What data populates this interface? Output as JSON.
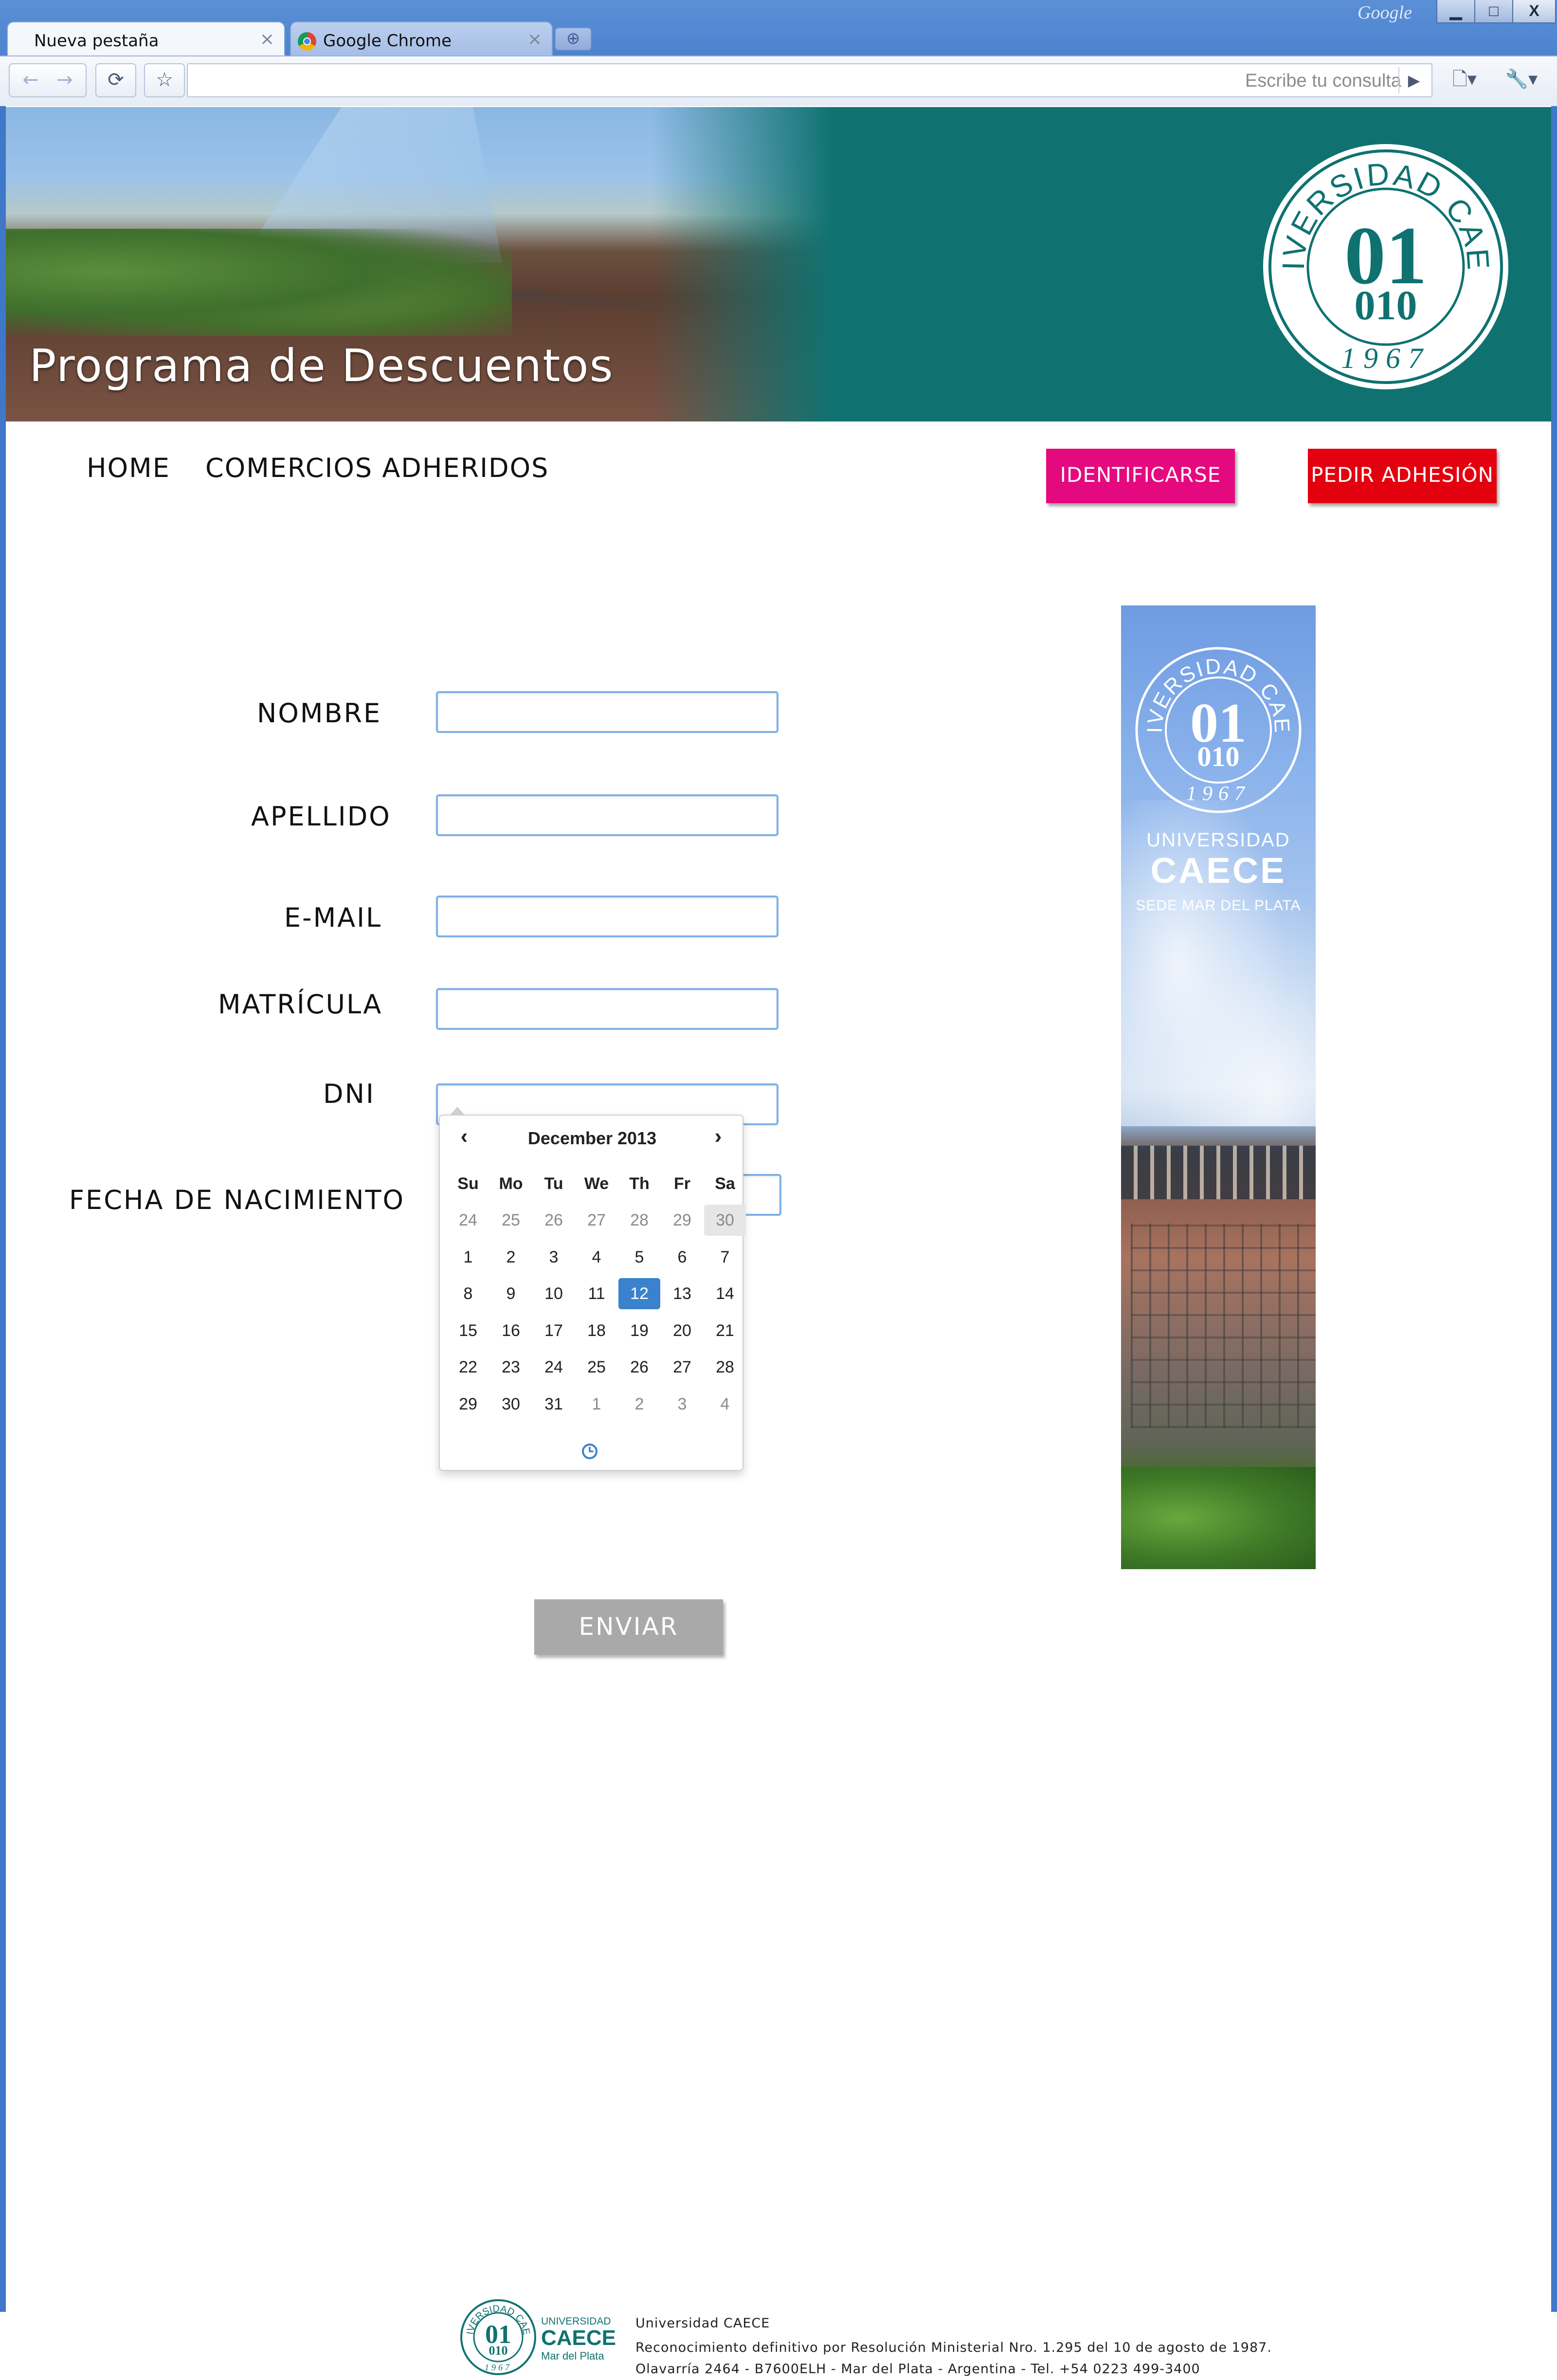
{
  "browser": {
    "tabs": [
      {
        "label": "Nueva pestaña",
        "active": true
      },
      {
        "label": "Google Chrome",
        "active": false
      }
    ],
    "window_brand": "Google",
    "omnibox": {
      "value": "",
      "placeholder": "Escribe tu consulta"
    },
    "window_buttons": {
      "minimize": "▁",
      "maximize": "□",
      "close": "X"
    }
  },
  "banner": {
    "title": "Programa de Descuentos",
    "seal": {
      "ring_text": "UNIVERSIDAD CAECE",
      "top_number": "01",
      "bottom_number": "010",
      "year": "1967"
    },
    "bg_color": "#0f7271"
  },
  "nav": {
    "links": [
      "HOME",
      "COMERCIOS ADHERIDOS"
    ],
    "identificarse": "IDENTIFICARSE",
    "pedir_adhesion": "PEDIR ADHESIÓN",
    "colors": {
      "identificarse": "#e5097f",
      "pedir_adhesion": "#e3000f"
    }
  },
  "form": {
    "nombre": {
      "label": "NOMBRE",
      "value": ""
    },
    "apellido": {
      "label": "APELLIDO",
      "value": ""
    },
    "email": {
      "label": "E-MAIL",
      "value": ""
    },
    "matricula": {
      "label": "MATRÍCULA",
      "value": ""
    },
    "dni": {
      "label": "DNI",
      "value": ""
    },
    "fecha": {
      "label": "FECHA DE NACIMIENTO",
      "value": "12/12/2013"
    },
    "submit": "ENVIAR"
  },
  "datepicker": {
    "prev": "‹",
    "next": "›",
    "title": "December 2013",
    "weekdays": [
      "Su",
      "Mo",
      "Tu",
      "We",
      "Th",
      "Fr",
      "Sa"
    ],
    "weeks": [
      [
        "24",
        "25",
        "26",
        "27",
        "28",
        "29",
        "30"
      ],
      [
        "1",
        "2",
        "3",
        "4",
        "5",
        "6",
        "7"
      ],
      [
        "8",
        "9",
        "10",
        "11",
        "12",
        "13",
        "14"
      ],
      [
        "15",
        "16",
        "17",
        "18",
        "19",
        "20",
        "21"
      ],
      [
        "22",
        "23",
        "24",
        "25",
        "26",
        "27",
        "28"
      ],
      [
        "29",
        "30",
        "31",
        "1",
        "2",
        "3",
        "4"
      ]
    ],
    "selected_day": "12",
    "accent_color": "#3a82cc"
  },
  "side_banner": {
    "seal": {
      "ring_text": "UNIVERSIDAD CAECE",
      "top_number": "01",
      "bottom_number": "010",
      "year": "1967"
    },
    "university": "UNIVERSIDAD",
    "name": "CAECE",
    "campus": "SEDE MAR DEL PLATA"
  },
  "footer": {
    "logo": {
      "ring_text": "UNIVERSIDAD CAECE",
      "top_number": "01",
      "bottom_number": "010",
      "year": "1967",
      "university": "UNIVERSIDAD",
      "name": "CAECE",
      "campus": "Mar del Plata"
    },
    "name": "Universidad CAECE",
    "recognition": "Reconocimiento definitivo por Resolución Ministerial Nro. 1.295 del 10 de agosto de 1987.",
    "address": "Olavarría 2464 - B7600ELH - Mar del Plata - Argentina - Tel. +54 0223 499-3400"
  }
}
